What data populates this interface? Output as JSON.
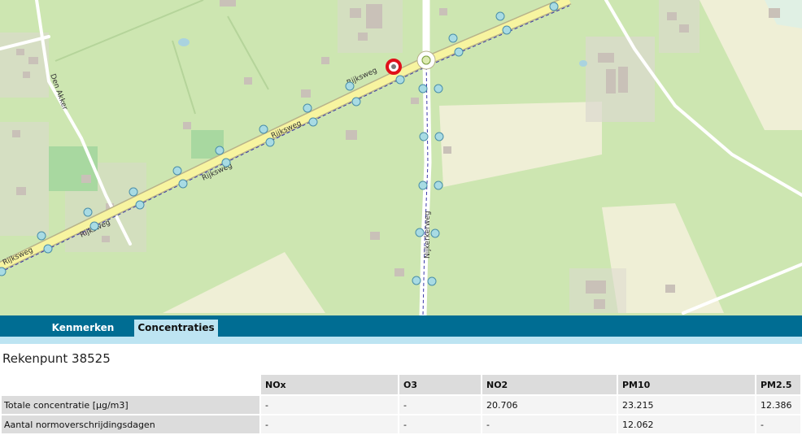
{
  "map": {
    "roads": {
      "rijksweg_labels": [
        "Rijksweg",
        "Rijksweg",
        "Rijksweg",
        "Rijksweg",
        "Rijksweg"
      ],
      "den_akker": "Den Akker",
      "nijkerkerweg": "Nijkerkerweg"
    },
    "colors": {
      "background": "#cde6b1",
      "main_road": "#f7f4a0",
      "marker": "#e0101a",
      "point": "#a8dbe3"
    }
  },
  "tabs": [
    {
      "label": "Kenmerken",
      "active": false
    },
    {
      "label": "Concentraties",
      "active": true
    }
  ],
  "panel": {
    "title": "Rekenpunt 38525",
    "columns": [
      "NOx",
      "O3",
      "NO2",
      "PM10",
      "PM2.5"
    ],
    "rows": [
      {
        "label": "Totale concentratie [µg/m3]",
        "values": [
          "-",
          "-",
          "20.706",
          "23.215",
          "12.386"
        ]
      },
      {
        "label": "Aantal normoverschrijdingsdagen",
        "values": [
          "-",
          "-",
          "-",
          "12.062",
          "-"
        ]
      }
    ]
  }
}
